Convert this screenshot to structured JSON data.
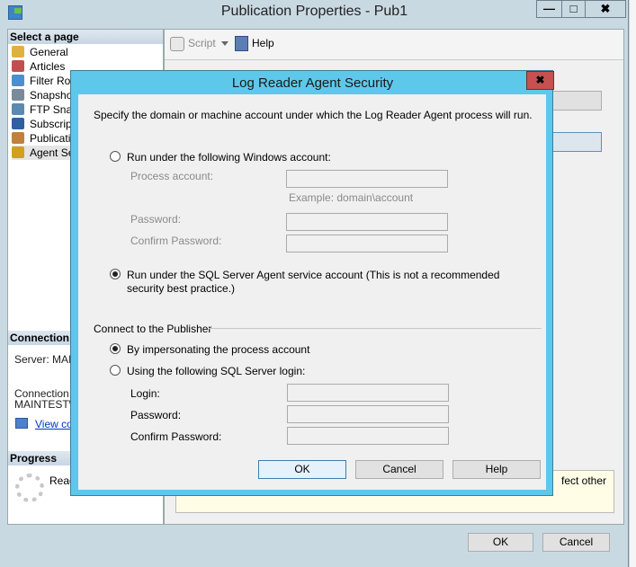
{
  "window": {
    "title": "Publication Properties - Pub1",
    "minimize": "—",
    "maximize": "□",
    "close": "✖"
  },
  "sidebar": {
    "header": "Select a page",
    "items": [
      {
        "label": "General",
        "icon": "general-icon"
      },
      {
        "label": "Articles",
        "icon": "articles-icon"
      },
      {
        "label": "Filter Rows",
        "icon": "filter-icon"
      },
      {
        "label": "Snapshot",
        "icon": "snapshot-icon"
      },
      {
        "label": "FTP Snapshot",
        "icon": "ftp-icon"
      },
      {
        "label": "Subscription Options",
        "icon": "subscription-icon"
      },
      {
        "label": "Publication Access List",
        "icon": "users-icon"
      },
      {
        "label": "Agent Security",
        "icon": "lock-icon"
      }
    ]
  },
  "connection": {
    "header": "Connection",
    "server": "Server: MAIN",
    "connection_label": "Connection:",
    "connection_value": "MAINTEST\\",
    "view_link": "View co"
  },
  "progress": {
    "header": "Progress",
    "status": "Read"
  },
  "toolbar": {
    "script": "Script",
    "help": "Help"
  },
  "background_text": {
    "note": "fect other"
  },
  "footer": {
    "ok": "OK",
    "cancel": "Cancel"
  },
  "dialog": {
    "title": "Log Reader Agent Security",
    "close": "✖",
    "intro": "Specify the domain or machine account under which the Log Reader Agent process will run.",
    "windows_account_option": "Run under the following Windows account:",
    "process_account_label": "Process account:",
    "process_account_value": "",
    "example": "Example: domain\\account",
    "password_label": "Password:",
    "confirm_password_label": "Confirm Password:",
    "sql_agent_option": "Run under the SQL Server Agent service account (This is not a recommended security best practice.)",
    "selected_run_option": "sql_agent",
    "connect_header": "Connect to the Publisher",
    "impersonate_option": "By impersonating the process account",
    "sql_login_option": "Using the following SQL Server login:",
    "selected_connect_option": "impersonate",
    "login_label": "Login:",
    "login_password_label": "Password:",
    "login_confirm_label": "Confirm Password:",
    "ok": "OK",
    "cancel": "Cancel",
    "help": "Help"
  }
}
